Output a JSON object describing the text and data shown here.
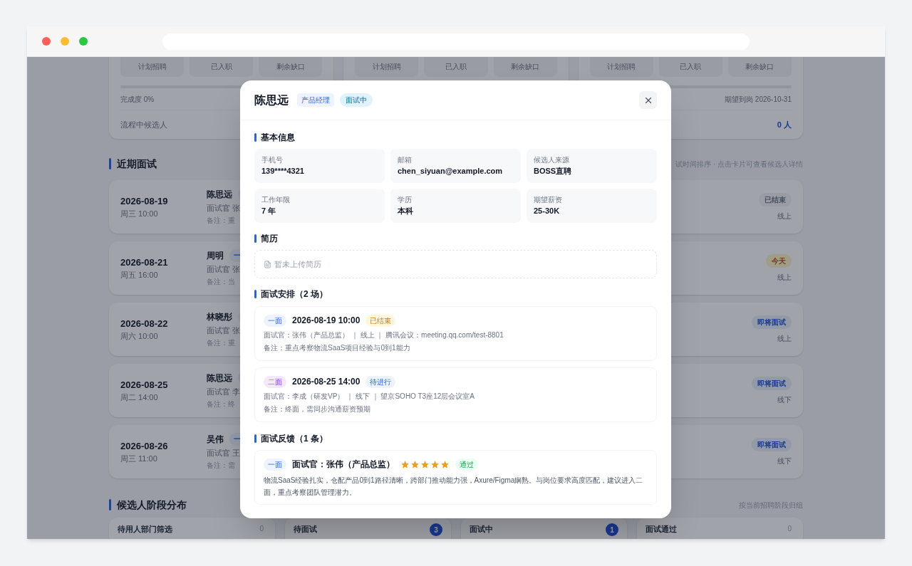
{
  "positions": [
    {
      "stats": [
        "计划招聘",
        "已入职",
        "剩余缺口"
      ],
      "level": 0,
      "progress_left": "完成度 0%",
      "pipeline_label": "流程中候选人"
    },
    {
      "stats": [
        "计划招聘",
        "已入职",
        "剩余缺口"
      ]
    },
    {
      "stats": [
        "计划招聘",
        "已入职",
        "剩余缺口"
      ],
      "level": 0,
      "progress_right": "期望到岗 2026-10-31",
      "pipeline_value": "0 人"
    }
  ],
  "interviews": {
    "title": "近期面试",
    "hint": "试时间排序 · 点击卡片可查看候选人详情",
    "rows": [
      {
        "date": "2026-08-19",
        "time": "周三 10:00",
        "name": "陈思远",
        "round": {
          "kind": "first"
        },
        "interviewer": "面试官 张",
        "note": "备注：重",
        "status": {
          "kind": "ended",
          "text": "已结束"
        },
        "mode": "线上"
      },
      {
        "date": "2026-08-21",
        "time": "周五 16:00",
        "name": "周明",
        "round": {
          "kind": "first",
          "text": "一"
        },
        "interviewer": "面试官 张",
        "note": "备注：当",
        "status": {
          "kind": "today",
          "text": "今天"
        },
        "mode": "线上"
      },
      {
        "date": "2026-08-22",
        "time": "周六 10:00",
        "name": "林晓彤",
        "round": {
          "kind": "first"
        },
        "interviewer": "面试官 张",
        "note": "备注：重",
        "status": {
          "kind": "upcoming",
          "text": "即将面试"
        },
        "mode": "线上"
      },
      {
        "date": "2026-08-25",
        "time": "周二 14:00",
        "name": "陈思远",
        "round": {
          "kind": "second"
        },
        "interviewer": "面试官 李",
        "note": "备注：终",
        "status": {
          "kind": "upcoming",
          "text": "即将面试"
        },
        "mode": "线下"
      },
      {
        "date": "2026-08-26",
        "time": "周三 11:00",
        "name": "吴伟",
        "round": {
          "kind": "first",
          "text": "一"
        },
        "interviewer": "面试官 王",
        "note": "备注：需",
        "status": {
          "kind": "upcoming",
          "text": "即将面试"
        },
        "mode": "线下"
      }
    ]
  },
  "stages": {
    "title": "候选人阶段分布",
    "hint": "按当前招聘阶段归组",
    "items": [
      {
        "label": "待用人部门筛选",
        "count": "0",
        "highlight": false
      },
      {
        "label": "待面试",
        "count": "3",
        "highlight": true
      },
      {
        "label": "面试中",
        "count": "1",
        "highlight": true
      },
      {
        "label": "面试通过",
        "count": "0",
        "highlight": false
      }
    ]
  },
  "modal": {
    "name": "陈思远",
    "position_tag": "产品经理",
    "status_tag": "面试中",
    "basic": {
      "title": "基本信息",
      "fields": [
        {
          "label": "手机号",
          "value": "139****4321"
        },
        {
          "label": "邮箱",
          "value": "chen_siyuan@example.com"
        },
        {
          "label": "候选人来源",
          "value": "BOSS直聘"
        },
        {
          "label": "工作年限",
          "value": "7 年"
        },
        {
          "label": "学历",
          "value": "本科"
        },
        {
          "label": "期望薪资",
          "value": "25-30K"
        }
      ]
    },
    "resume": {
      "title": "简历",
      "empty_text": "暂未上传简历"
    },
    "schedule": {
      "title": "面试安排（2 场）",
      "items": [
        {
          "round": {
            "kind": "first",
            "text": "一面"
          },
          "datetime": "2026-08-19 10:00",
          "status": {
            "kind": "ended",
            "text": "已结束"
          },
          "detail": "面试官：张伟（产品总监） ｜ 线上 ｜ 腾讯会议：meeting.qq.com/test-8801",
          "note": "备注：重点考察物流SaaS项目经验与0到1能力"
        },
        {
          "round": {
            "kind": "second",
            "text": "二面"
          },
          "datetime": "2026-08-25 14:00",
          "status": {
            "kind": "pending",
            "text": "待进行"
          },
          "detail": "面试官：李成（研发VP） ｜ 线下 ｜ 望京SOHO T3座12层会议室A",
          "note": "备注：终面，需同步沟通薪资预期"
        }
      ]
    },
    "feedback": {
      "title": "面试反馈（1 条）",
      "items": [
        {
          "round": {
            "kind": "first",
            "text": "一面"
          },
          "interviewer": "面试官：张伟（产品总监）",
          "stars": 5,
          "result": {
            "kind": "pass",
            "text": "通过"
          },
          "comment": "物流SaaS经验扎实，仓配产品0到1路径清晰，跨部门推动能力强，Axure/Figma娴熟。与岗位要求高度匹配，建议进入二面，重点考察团队管理潜力。"
        }
      ]
    }
  }
}
